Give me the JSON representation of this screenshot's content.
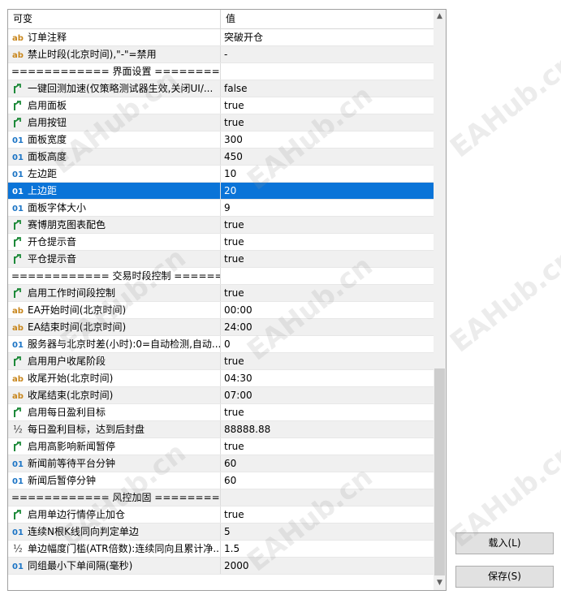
{
  "header": {
    "col_name": "可变",
    "col_value": "值"
  },
  "rows": [
    {
      "icon": "ab",
      "name": "订单注释",
      "value": "突破开仓"
    },
    {
      "icon": "ab",
      "name": "禁止时段(北京时间),\"-\"=禁用",
      "value": "-"
    },
    {
      "icon": "",
      "name": "============ 界面设置 ============",
      "value": ""
    },
    {
      "icon": "bool",
      "name": "一键回测加速(仅策略测试器生效,关闭UI/...",
      "value": "false"
    },
    {
      "icon": "bool",
      "name": "启用面板",
      "value": "true"
    },
    {
      "icon": "bool",
      "name": "启用按钮",
      "value": "true"
    },
    {
      "icon": "01",
      "name": "面板宽度",
      "value": "300"
    },
    {
      "icon": "01",
      "name": "面板高度",
      "value": "450"
    },
    {
      "icon": "01",
      "name": "左边距",
      "value": "10"
    },
    {
      "icon": "01",
      "name": "上边距",
      "value": "20"
    },
    {
      "icon": "01",
      "name": "面板字体大小",
      "value": "9"
    },
    {
      "icon": "bool",
      "name": "赛博朋克图表配色",
      "value": "true"
    },
    {
      "icon": "bool",
      "name": "开仓提示音",
      "value": "true"
    },
    {
      "icon": "bool",
      "name": "平仓提示音",
      "value": "true"
    },
    {
      "icon": "",
      "name": "============ 交易时段控制 ========...",
      "value": ""
    },
    {
      "icon": "bool",
      "name": "启用工作时间段控制",
      "value": "true"
    },
    {
      "icon": "ab",
      "name": "EA开始时间(北京时间)",
      "value": "00:00"
    },
    {
      "icon": "ab",
      "name": "EA结束时间(北京时间)",
      "value": "24:00"
    },
    {
      "icon": "01",
      "name": "服务器与北京时差(小时):0=自动检测,自动...",
      "value": "0"
    },
    {
      "icon": "bool",
      "name": "启用用户收尾阶段",
      "value": "true"
    },
    {
      "icon": "ab",
      "name": "收尾开始(北京时间)",
      "value": "04:30"
    },
    {
      "icon": "ab",
      "name": "收尾结束(北京时间)",
      "value": "07:00"
    },
    {
      "icon": "bool",
      "name": "启用每日盈利目标",
      "value": "true"
    },
    {
      "icon": "half",
      "name": "每日盈利目标，达到后封盘",
      "value": "88888.88"
    },
    {
      "icon": "bool",
      "name": "启用高影响新闻暂停",
      "value": "true"
    },
    {
      "icon": "01",
      "name": "新闻前等待平台分钟",
      "value": "60"
    },
    {
      "icon": "01",
      "name": "新闻后暂停分钟",
      "value": "60"
    },
    {
      "icon": "",
      "name": "============ 风控加固 ============",
      "value": ""
    },
    {
      "icon": "bool",
      "name": "启用单边行情停止加仓",
      "value": "true"
    },
    {
      "icon": "01",
      "name": "连续N根K线同向判定单边",
      "value": "5"
    },
    {
      "icon": "half",
      "name": "单边幅度门槛(ATR倍数):连续同向且累计净...",
      "value": "1.5"
    },
    {
      "icon": "01",
      "name": "同组最小下单间隔(毫秒)",
      "value": "2000"
    }
  ],
  "selected_row": 9,
  "icons": {
    "ab": "ab",
    "01": "01",
    "half": "½"
  },
  "buttons": {
    "load": "载入(L)",
    "save": "保存(S)"
  },
  "watermark": "EAHub.cn",
  "colors": {
    "selection": "#0a74d8",
    "bool_icon": "#1e8a3a",
    "ab_icon": "#c8861c",
    "num_icon": "#1b74c5"
  }
}
